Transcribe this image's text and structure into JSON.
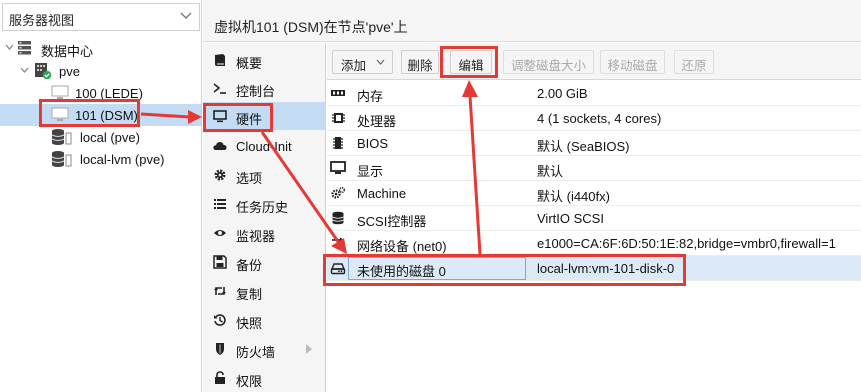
{
  "tree": {
    "view_select": "服务器视图",
    "datacenter": "数据中心",
    "node": "pve",
    "vms": [
      {
        "label": "100 (LEDE)"
      },
      {
        "label": "101 (DSM)"
      }
    ],
    "storages": [
      {
        "label": "local (pve)"
      },
      {
        "label": "local-lvm (pve)"
      }
    ]
  },
  "header": {
    "title": "虚拟机101 (DSM)在节点'pve'上"
  },
  "subnav": {
    "items": [
      {
        "label": "概要",
        "icon": "book-icon"
      },
      {
        "label": "控制台",
        "icon": "terminal-icon"
      },
      {
        "label": "硬件",
        "icon": "monitor-icon"
      },
      {
        "label": "Cloud-Init",
        "icon": "cloud-icon"
      },
      {
        "label": "选项",
        "icon": "gear-icon"
      },
      {
        "label": "任务历史",
        "icon": "list-icon"
      },
      {
        "label": "监视器",
        "icon": "eye-icon"
      },
      {
        "label": "备份",
        "icon": "floppy-icon"
      },
      {
        "label": "复制",
        "icon": "retweet-icon"
      },
      {
        "label": "快照",
        "icon": "history-icon"
      },
      {
        "label": "防火墙",
        "icon": "shield-icon"
      },
      {
        "label": "权限",
        "icon": "unlock-icon"
      }
    ]
  },
  "toolbar": {
    "add": "添加",
    "remove": "删除",
    "edit": "编辑",
    "resize": "调整磁盘大小",
    "move": "移动磁盘",
    "revert": "还原"
  },
  "hardware": [
    {
      "key": "内存",
      "value": "2.00 GiB",
      "icon": "memory-icon"
    },
    {
      "key": "处理器",
      "value": "4 (1 sockets, 4 cores)",
      "icon": "cpu-icon"
    },
    {
      "key": "BIOS",
      "value": "默认 (SeaBIOS)",
      "icon": "microchip-icon"
    },
    {
      "key": "显示",
      "value": "默认",
      "icon": "desktop-icon"
    },
    {
      "key": "Machine",
      "value": "默认 (i440fx)",
      "icon": "cogs-icon"
    },
    {
      "key": "SCSI控制器",
      "value": "VirtIO SCSI",
      "icon": "database-icon"
    },
    {
      "key": "网络设备 (net0)",
      "value": "e1000=CA:6F:6D:50:1E:82,bridge=vmbr0,firewall=1",
      "icon": "exchange-icon"
    },
    {
      "key": "未使用的磁盘 0",
      "value": "local-lvm:vm-101-disk-0",
      "icon": "hdd-icon"
    }
  ],
  "colors": {
    "annotation": "#e53935",
    "selection": "#c4dcf3",
    "panel_bg": "#f5f5f5"
  }
}
